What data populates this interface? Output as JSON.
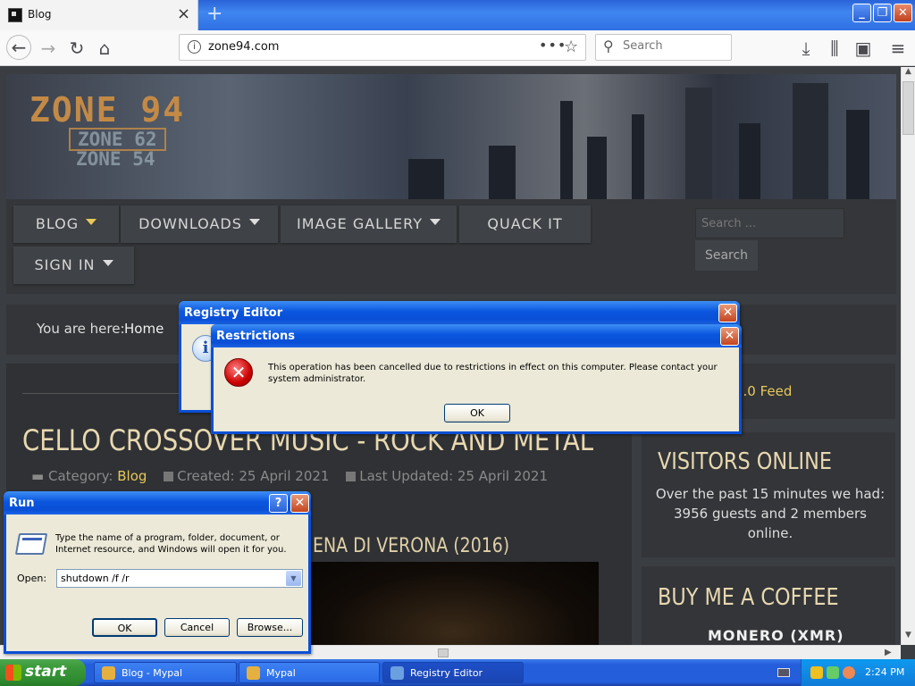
{
  "browser": {
    "tab_title": "Blog",
    "tab_close": "×",
    "new_tab": "+",
    "url": "zone94.com",
    "search_placeholder": "Search",
    "menu_dots": "•••"
  },
  "site": {
    "logo_main": "ZONE 94",
    "logo_sub1": "ZONE 62",
    "logo_sub2": "ZONE 54",
    "nav": {
      "blog": "BLOG",
      "downloads": "DOWNLOADS",
      "image_gallery": "IMAGE GALLERY",
      "quack_it": "QUACK IT",
      "sign_in": "SIGN IN"
    },
    "search_placeholder": "Search ...",
    "search_button": "Search",
    "breadcrumb_label": "You are here:",
    "breadcrumb_home": "Home",
    "article": {
      "title": "CELLO CROSSOVER MUSIC - ROCK AND METAL",
      "category_label": "Category:",
      "category": "Blog",
      "created": "Created: 25 April 2021",
      "updated": "Last Updated: 25 April 2021",
      "video_title": "ENA DI VERONA (2016)"
    },
    "sidebar": {
      "rss_partial": "2.0 Feed",
      "visitors_title": "VISITORS ONLINE",
      "visitors_text": "Over the past 15 minutes we had: 3956 guests and 2 members online.",
      "coffee_title": "BUY ME A COFFEE",
      "coffee_sub": "MONERO (XMR)"
    }
  },
  "dialogs": {
    "registry": {
      "title": "Registry Editor",
      "icon": "i"
    },
    "restrictions": {
      "title": "Restrictions",
      "icon": "✕",
      "message": "This operation has been cancelled due to restrictions in effect on this computer. Please contact your system administrator.",
      "ok": "OK"
    },
    "run": {
      "title": "Run",
      "help": "?",
      "description": "Type the name of a program, folder, document, or Internet resource, and Windows will open it for you.",
      "open_label": "Open:",
      "open_value": "shutdown /f /r",
      "ok": "OK",
      "cancel": "Cancel",
      "browse": "Browse..."
    }
  },
  "taskbar": {
    "start": "start",
    "tasks": [
      "Blog - Mypal",
      "Mypal",
      "Registry Editor"
    ],
    "clock": "2:24 PM"
  }
}
